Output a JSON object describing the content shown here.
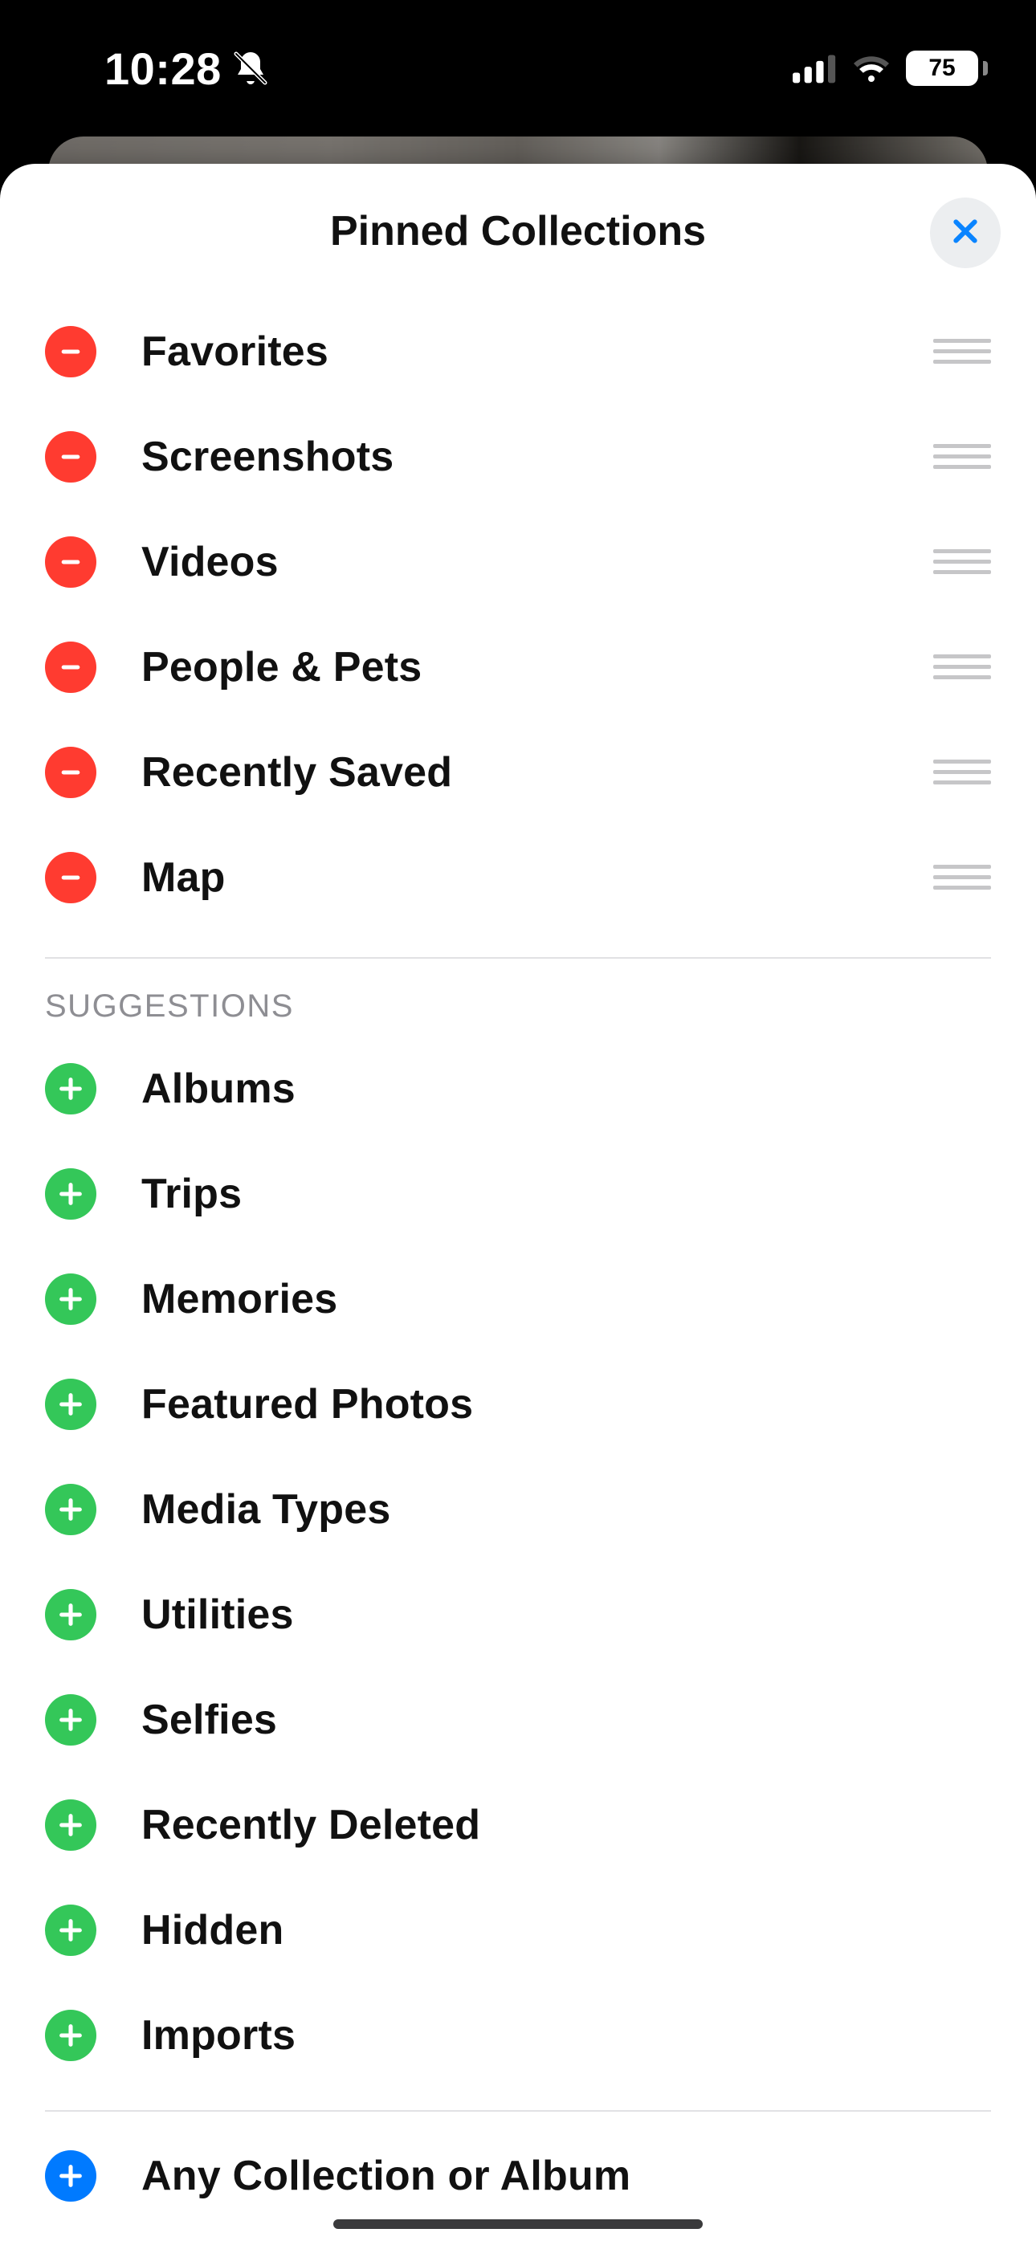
{
  "status": {
    "time": "10:28",
    "battery_pct": "75"
  },
  "sheet": {
    "title": "Pinned Collections"
  },
  "pinned": [
    {
      "label": "Favorites"
    },
    {
      "label": "Screenshots"
    },
    {
      "label": "Videos"
    },
    {
      "label": "People & Pets"
    },
    {
      "label": "Recently Saved"
    },
    {
      "label": "Map"
    }
  ],
  "suggestions_header": "SUGGESTIONS",
  "suggestions": [
    {
      "label": "Albums"
    },
    {
      "label": "Trips"
    },
    {
      "label": "Memories"
    },
    {
      "label": "Featured Photos"
    },
    {
      "label": "Media Types"
    },
    {
      "label": "Utilities"
    },
    {
      "label": "Selfies"
    },
    {
      "label": "Recently Deleted"
    },
    {
      "label": "Hidden"
    },
    {
      "label": "Imports"
    }
  ],
  "any_collection_label": "Any Collection or Album"
}
